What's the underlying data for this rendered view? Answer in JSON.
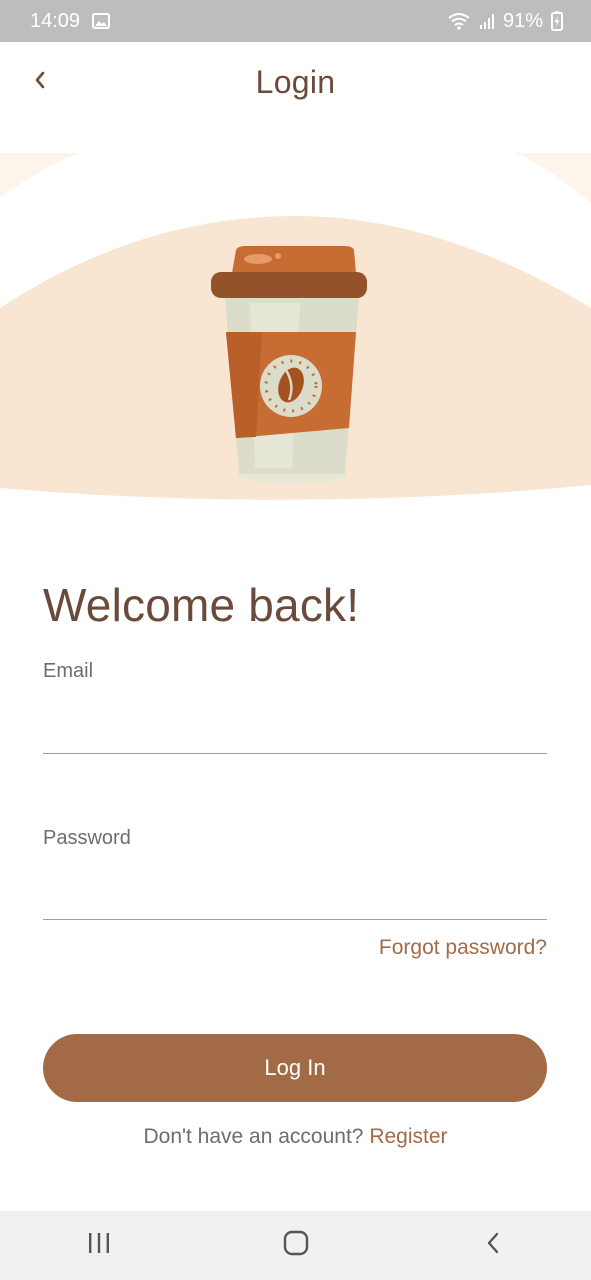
{
  "status_bar": {
    "time": "14:09",
    "battery": "91%",
    "icons": [
      "gallery-icon",
      "wifi-icon",
      "signal-icon",
      "battery-charging-icon"
    ]
  },
  "app_bar": {
    "title": "Login",
    "back_icon": "chevron-left-icon"
  },
  "hero": {
    "illustration": "coffee-cup-illustration",
    "background_color": "#f9e6d2"
  },
  "form": {
    "heading": "Welcome back!",
    "email": {
      "label": "Email",
      "value": "",
      "placeholder": ""
    },
    "password": {
      "label": "Password",
      "value": "",
      "placeholder": ""
    },
    "forgot_password": "Forgot password?",
    "login_button": "Log In",
    "register_prompt": "Don't have an account?",
    "register_link": "Register"
  },
  "nav_bar": {
    "items": [
      "recents-icon",
      "home-icon",
      "back-icon"
    ]
  },
  "colors": {
    "accent": "#a36a46",
    "title_text": "#6a4a3b",
    "label_text": "#6d6d6d",
    "status_bar": "#bdbdbd"
  }
}
